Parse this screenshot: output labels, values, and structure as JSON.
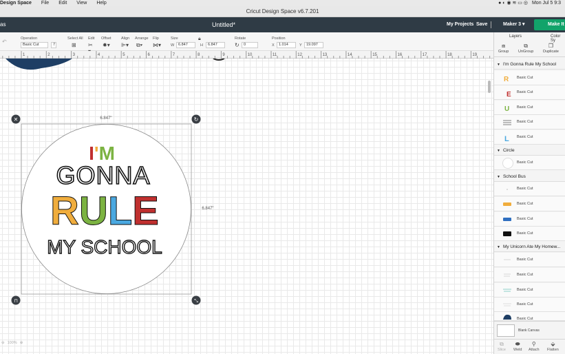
{
  "menubar": {
    "app": "Design Space",
    "items": [
      "File",
      "Edit",
      "View",
      "Help"
    ],
    "clock": "Mon Jul 5  9:3"
  },
  "window": {
    "title": "Cricut Design Space  v6.7.201"
  },
  "header": {
    "left_text": "as",
    "doc_title": "Untitled*",
    "my_projects": "My Projects",
    "save": "Save",
    "machine": "Maker 3",
    "make_it": "Make It"
  },
  "toolbar": {
    "operation": {
      "label": "Operation",
      "value": "Basic Cut",
      "num": "7"
    },
    "select_all": "Select All",
    "edit": "Edit",
    "offset": "Offset",
    "align": "Align",
    "arrange": "Arrange",
    "flip": "Flip",
    "size": {
      "label": "Size",
      "w_label": "W",
      "w": "6.847",
      "h_label": "H",
      "h": "6.847"
    },
    "rotate": {
      "label": "Rotate",
      "value": "0"
    },
    "position": {
      "label": "Position",
      "x_label": "X",
      "x": "1.014",
      "y_label": "Y",
      "y": "19.097"
    }
  },
  "ruler": {
    "ticks": [
      "1",
      "2",
      "3",
      "4",
      "5",
      "6",
      "7",
      "8",
      "9",
      "10",
      "11",
      "12",
      "13",
      "14",
      "15",
      "16",
      "17",
      "18",
      "19"
    ]
  },
  "canvas": {
    "dim_top": "6.847\"",
    "dim_right": "6.847\"",
    "art": {
      "line1": "I'M",
      "line2": "GONNA",
      "line3": "RULE",
      "line4": "MY SCHOOL"
    },
    "zoom": "100%"
  },
  "panel": {
    "tabs": [
      "Layers",
      "Color Sy"
    ],
    "tools": [
      "Group",
      "UnGroup",
      "Duplicate"
    ],
    "groups": [
      {
        "name": "I'm Gonna Rule My School",
        "items": [
          "Basic Cut",
          "Basic Cut",
          "Basic Cut",
          "Basic Cut",
          "Basic Cut"
        ]
      },
      {
        "name": "Circle",
        "items": [
          "Basic Cut"
        ]
      },
      {
        "name": "School Bus",
        "items": [
          "Basic Cut",
          "Basic Cut",
          "Basic Cut",
          "Basic Cut"
        ]
      },
      {
        "name": "My Unicorn Ate My Homew...",
        "items": [
          "Basic Cut",
          "Basic Cut",
          "Basic Cut",
          "Basic Cut",
          "Basic Cut"
        ]
      }
    ],
    "blank_canvas": "Blank Canvas",
    "bottom_tools": [
      "Slice",
      "Weld",
      "Attach",
      "Flatten"
    ]
  },
  "colors": {
    "header": "#2f3b45",
    "make": "#12a36a",
    "red": "#c0302f",
    "green": "#7cb342",
    "yellow": "#f0ad3d",
    "blue": "#4aa8e0",
    "navy": "#1e3e64"
  }
}
